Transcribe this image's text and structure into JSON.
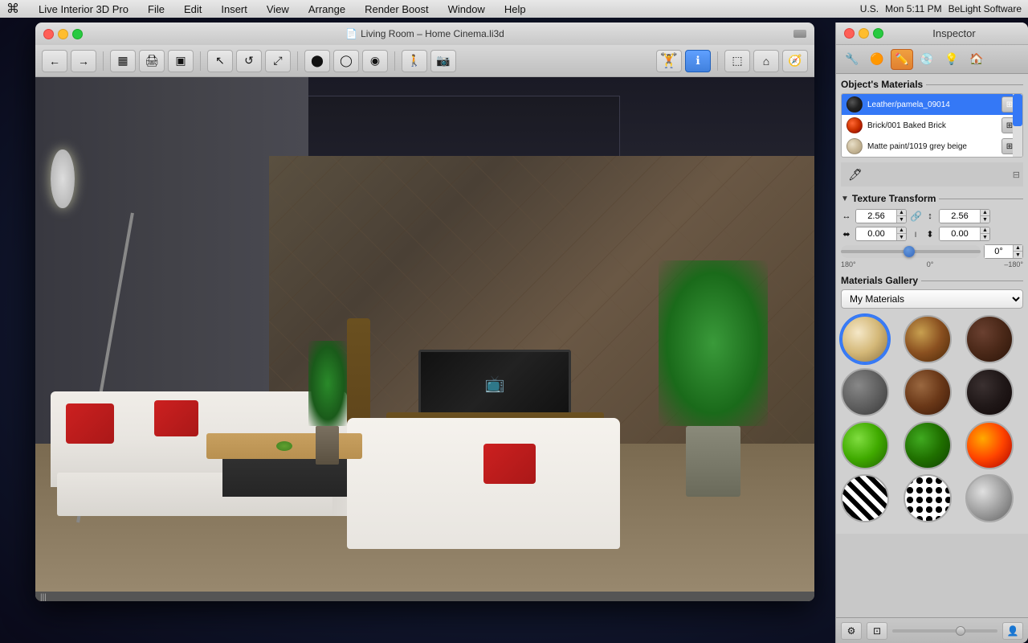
{
  "menubar": {
    "apple": "⌘",
    "app_name": "Live Interior 3D Pro",
    "menus": [
      "File",
      "Edit",
      "Insert",
      "View",
      "Arrange",
      "Render Boost",
      "Window",
      "Help"
    ],
    "right_items": [
      "U.S.",
      "Mon 5:11 PM",
      "BeLight Software"
    ]
  },
  "window": {
    "title": "Living Room – Home Cinema.li3d",
    "buttons": {
      "close": "close",
      "minimize": "minimize",
      "maximize": "maximize"
    }
  },
  "inspector": {
    "title": "Inspector",
    "tabs": [
      {
        "icon": "🔧",
        "label": "object"
      },
      {
        "icon": "🔵",
        "label": "material-ball"
      },
      {
        "icon": "✏️",
        "label": "edit",
        "active": true
      },
      {
        "icon": "💿",
        "label": "texture"
      },
      {
        "icon": "💡",
        "label": "light"
      },
      {
        "icon": "🏠",
        "label": "room"
      }
    ],
    "objects_materials": {
      "title": "Object's Materials",
      "materials": [
        {
          "name": "Leather/pamela_09014",
          "color": "#2a2a2a",
          "selected": true
        },
        {
          "name": "Brick/001 Baked Brick",
          "color": "#cc3300"
        },
        {
          "name": "Matte paint/1019 grey beige",
          "color": "#d4c8b0"
        }
      ],
      "scrollbar_thumb_top": "0%"
    },
    "texture_transform": {
      "title": "Texture Transform",
      "scale_h": "2.56",
      "scale_v": "2.56",
      "offset_h": "0.00",
      "offset_v": "0.00",
      "rotation": "0°",
      "rotation_min": "180°",
      "rotation_mid": "0°",
      "rotation_max": "–180°"
    },
    "materials_gallery": {
      "title": "Materials Gallery",
      "dropdown_value": "My Materials",
      "items": [
        {
          "id": "beige",
          "style": "mat-beige",
          "selected": true
        },
        {
          "id": "wood",
          "style": "mat-wood"
        },
        {
          "id": "brick-dark",
          "style": "mat-brick-dark"
        },
        {
          "id": "stone",
          "style": "mat-stone"
        },
        {
          "id": "walnut",
          "style": "mat-walnut"
        },
        {
          "id": "ebony",
          "style": "mat-ebony"
        },
        {
          "id": "green-bright",
          "style": "mat-green-bright"
        },
        {
          "id": "green-dark",
          "style": "mat-green-dark"
        },
        {
          "id": "fire",
          "style": "mat-fire"
        },
        {
          "id": "zebra",
          "style": "mat-zebra"
        },
        {
          "id": "spots",
          "style": "mat-spots"
        },
        {
          "id": "metal",
          "style": "mat-metal"
        }
      ]
    }
  }
}
